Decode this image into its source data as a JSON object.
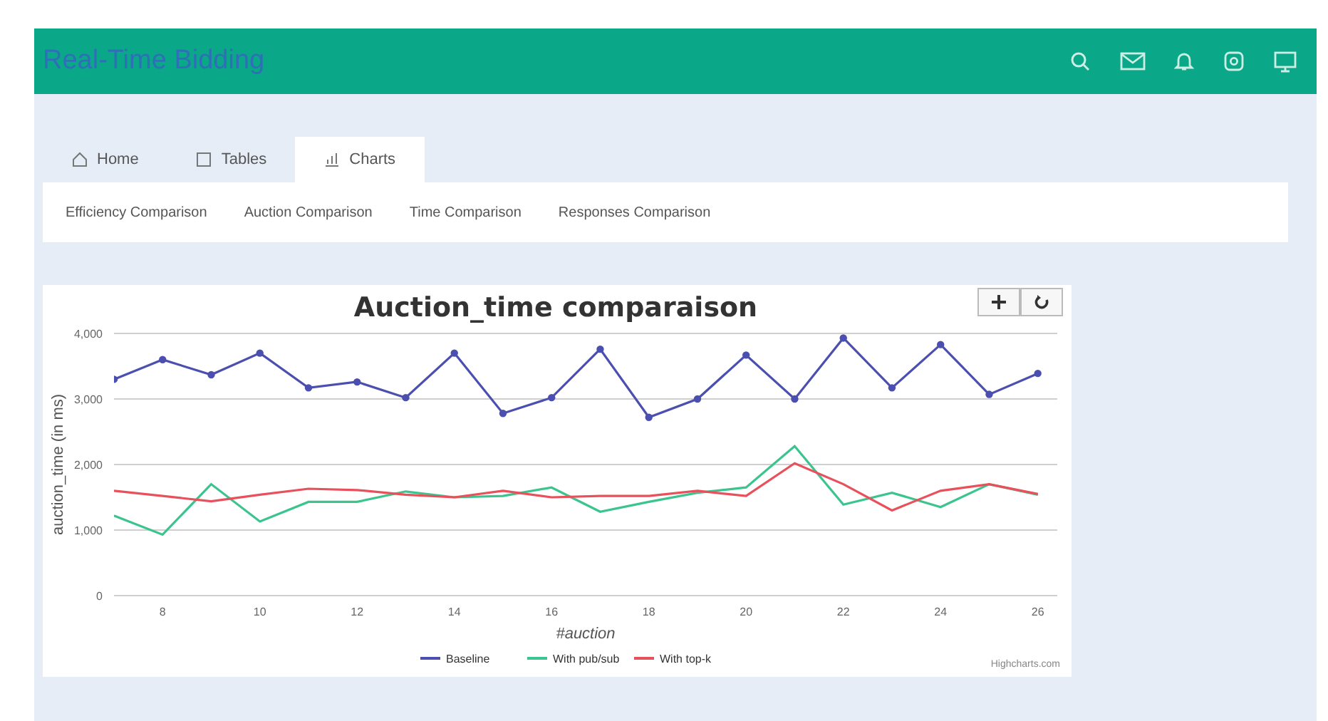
{
  "header": {
    "title": "Real-Time Bidding"
  },
  "tabs": [
    {
      "label": "Home",
      "selected": false
    },
    {
      "label": "Tables",
      "selected": false
    },
    {
      "label": "Charts",
      "selected": true
    }
  ],
  "subtabs": [
    "Efficiency Comparison",
    "Auction Comparison",
    "Time Comparison",
    "Responses Comparison"
  ],
  "chart": {
    "chart_data": {
      "type": "line",
      "title": "Auction_time comparaison",
      "xlabel": "#auction",
      "ylabel": "auction_time (in ms)",
      "x": [
        7,
        8,
        9,
        10,
        11,
        12,
        13,
        14,
        15,
        16,
        17,
        18,
        19,
        20,
        21,
        22,
        23,
        24,
        25,
        26
      ],
      "grid": true,
      "legend": true,
      "xlim": [
        7,
        26.4
      ],
      "ylim": [
        0,
        4000
      ],
      "xticks": [
        8,
        10,
        12,
        14,
        16,
        18,
        20,
        22,
        24,
        26
      ],
      "yticks": [
        {
          "value": 0,
          "label": "0"
        },
        {
          "value": 1000,
          "label": "1,000"
        },
        {
          "value": 2000,
          "label": "2,000"
        },
        {
          "value": 3000,
          "label": "3,000"
        },
        {
          "value": 4000,
          "label": "4,000"
        }
      ],
      "series": [
        {
          "name": "Baseline",
          "color": "#4b4fb0",
          "marker": true,
          "values": [
            3300,
            3600,
            3370,
            3700,
            3170,
            3260,
            3020,
            3700,
            2780,
            3020,
            3760,
            2720,
            3000,
            3670,
            3000,
            3930,
            3170,
            3830,
            3070,
            3390
          ]
        },
        {
          "name": "With pub/sub",
          "color": "#3cc48f",
          "marker": false,
          "values": [
            1220,
            930,
            1700,
            1130,
            1430,
            1430,
            1590,
            1500,
            1520,
            1650,
            1280,
            1430,
            1570,
            1650,
            2280,
            1390,
            1570,
            1350,
            1700,
            1540
          ]
        },
        {
          "name": "With top-k",
          "color": "#e8505b",
          "marker": false,
          "values": [
            1600,
            1520,
            1440,
            1540,
            1630,
            1610,
            1540,
            1500,
            1600,
            1500,
            1520,
            1520,
            1600,
            1520,
            2020,
            1700,
            1300,
            1600,
            1700,
            1550
          ]
        }
      ]
    },
    "credit": "Highcharts.com"
  }
}
